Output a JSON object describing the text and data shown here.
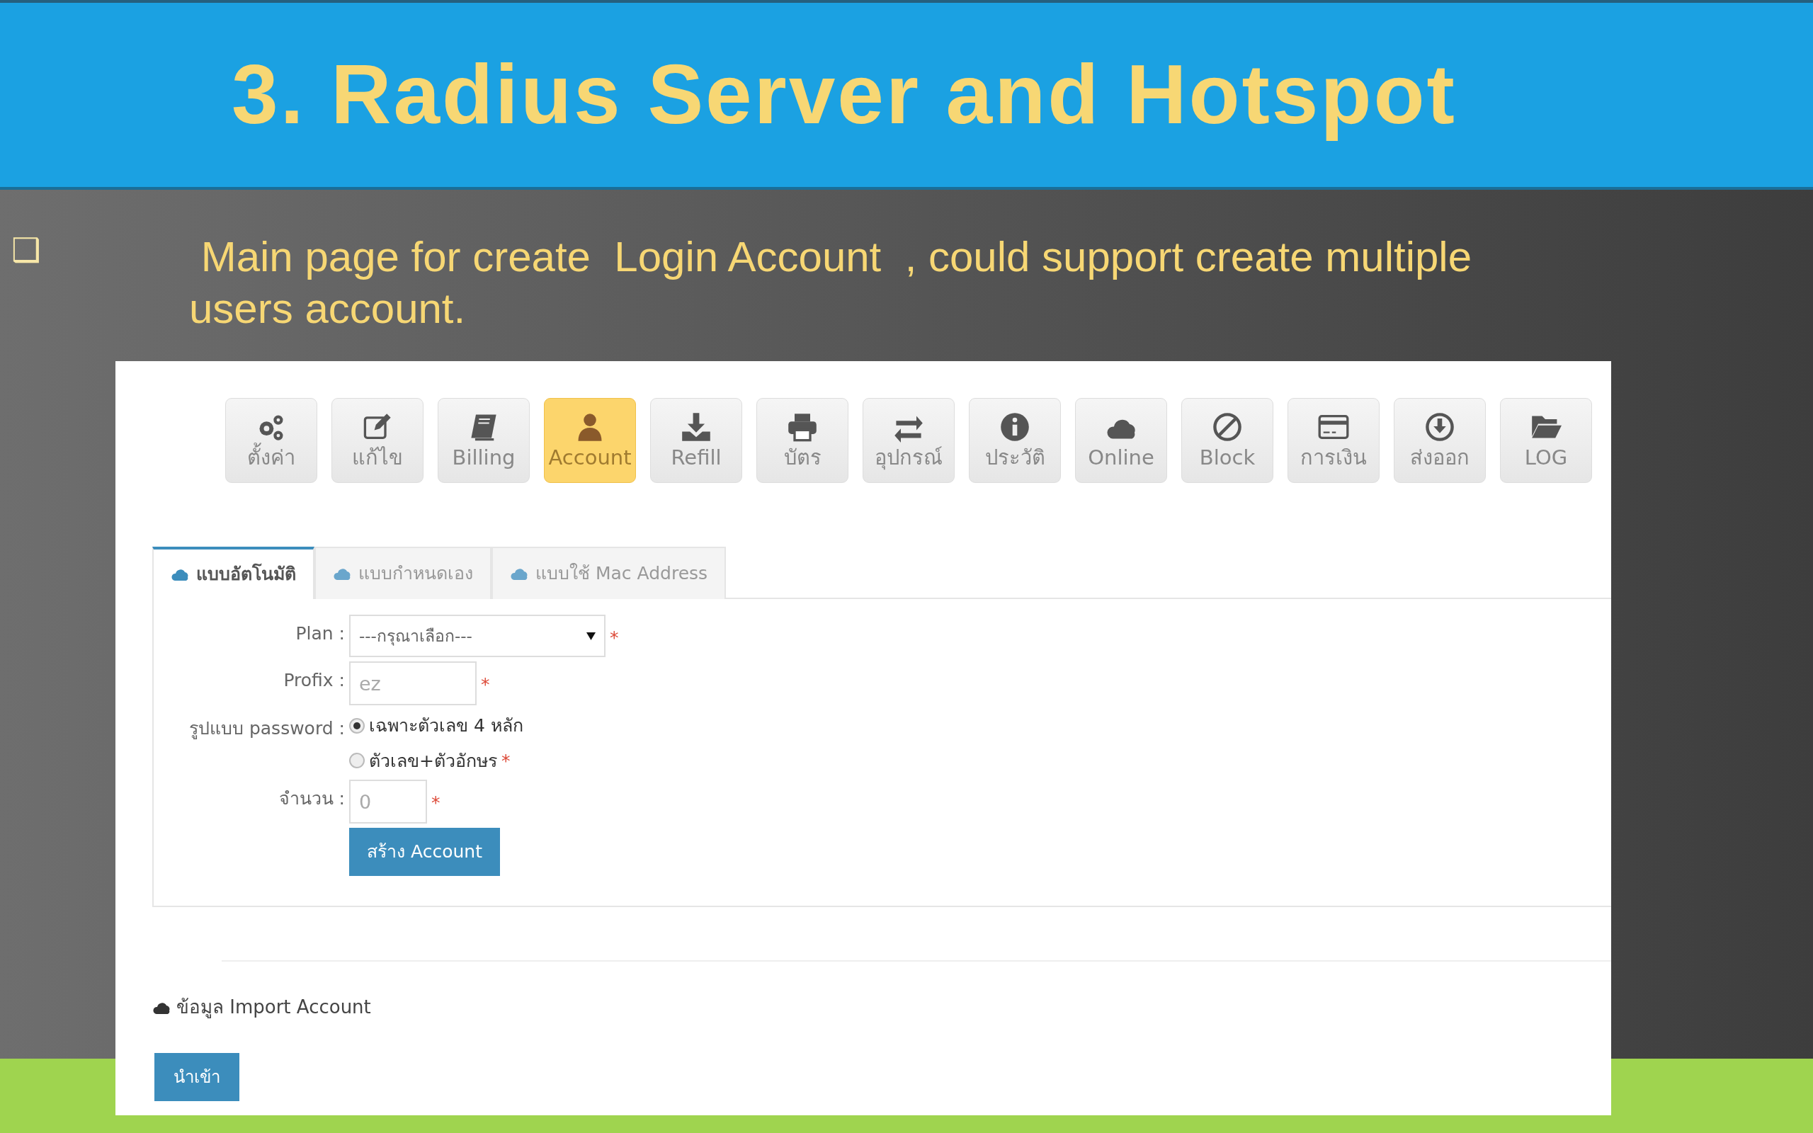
{
  "slide": {
    "title": "3. Radius Server and Hotspot",
    "bullet": {
      "marker": "❑",
      "text": " Main page for create  Login Account  , could support create multiple users account."
    }
  },
  "screenshot": {
    "toolbar": [
      {
        "label": "ตั้งค่า",
        "selected": false
      },
      {
        "label": "แก้ไข",
        "selected": false
      },
      {
        "label": "Billing",
        "selected": false
      },
      {
        "label": "Account",
        "selected": true
      },
      {
        "label": "Refill",
        "selected": false
      },
      {
        "label": "บัตร",
        "selected": false
      },
      {
        "label": "อุปกรณ์",
        "selected": false
      },
      {
        "label": "ประวัติ",
        "selected": false
      },
      {
        "label": "Online",
        "selected": false
      },
      {
        "label": "Block",
        "selected": false
      },
      {
        "label": "การเงิน",
        "selected": false
      },
      {
        "label": "ส่งออก",
        "selected": false
      },
      {
        "label": "LOG",
        "selected": false
      }
    ],
    "tabs": [
      {
        "label": "แบบอัตโนมัติ",
        "selected": true
      },
      {
        "label": "แบบกำหนดเอง",
        "selected": false
      },
      {
        "label": "แบบใช้ Mac Address",
        "selected": false
      }
    ],
    "form": {
      "plan": {
        "label": "Plan :",
        "value": "---กรุณาเลือก---",
        "required_mark": "*"
      },
      "prefix": {
        "label": "Profix :",
        "placeholder": "ez",
        "required_mark": "*"
      },
      "password": {
        "label": "รูปแบบ password :",
        "options": [
          {
            "label": "เฉพาะตัวเลข 4 หลัก",
            "selected": true
          },
          {
            "label": "ตัวเลข+ตัวอักษร",
            "selected": false,
            "required_mark": "*"
          }
        ]
      },
      "amount": {
        "label": "จำนวน :",
        "placeholder": "0",
        "required_mark": "*"
      },
      "submit": "สร้าง Account"
    },
    "import": {
      "heading": "ข้อมูล Import Account",
      "button": "นำเข้า"
    }
  }
}
